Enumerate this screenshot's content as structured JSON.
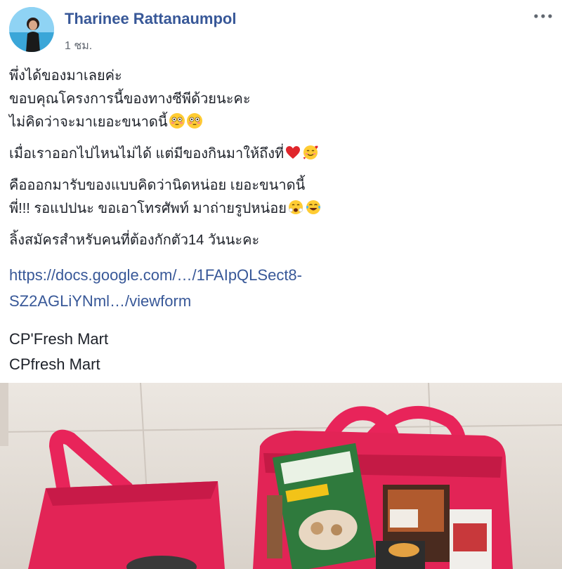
{
  "post": {
    "author": "Tharinee Rattanaumpol",
    "time": "1 ชม.",
    "paragraphs": [
      [
        "พึ่งได้ของมาเลยค่ะ",
        "ขอบคุณโครงการนี้ของทางซีพีด้วยนะคะ",
        "ไม่คิดว่าจะมาเยอะขนาดนี้"
      ],
      [
        "เมื่อเราออกไปไหนไม่ได้ แต่มีของกินมาให้ถึงที่"
      ],
      [
        "คือออกมารับของแบบคิดว่านิดหน่อย เยอะขนาดนี้",
        "พี่!!! รอแปปนะ ขอเอาโทรศัพท์ มาถ่ายรูปหน่อย"
      ],
      [
        "ลิ้งสมัครสำหรับคนที่ต้องกักตัว14 วันนะคะ"
      ]
    ],
    "link_lines": [
      "https://docs.google.com/…/1FAIpQLSect8-",
      "SZ2AGLiYNml…/viewform"
    ],
    "mart_lines": [
      "CP'Fresh Mart",
      "CPfresh Mart"
    ]
  },
  "icons": {
    "more": "more-horizontal-icon",
    "flushed": "flushed-face-emoji",
    "heart": "red-heart-emoji",
    "smiling_hearts": "smiling-face-with-hearts-emoji",
    "mask_face": "face-with-open-mouth-emoji",
    "laughing": "tears-of-joy-emoji"
  },
  "colors": {
    "link": "#385898",
    "text": "#1d2129",
    "meta": "#616770",
    "bag": "#e8245a"
  }
}
